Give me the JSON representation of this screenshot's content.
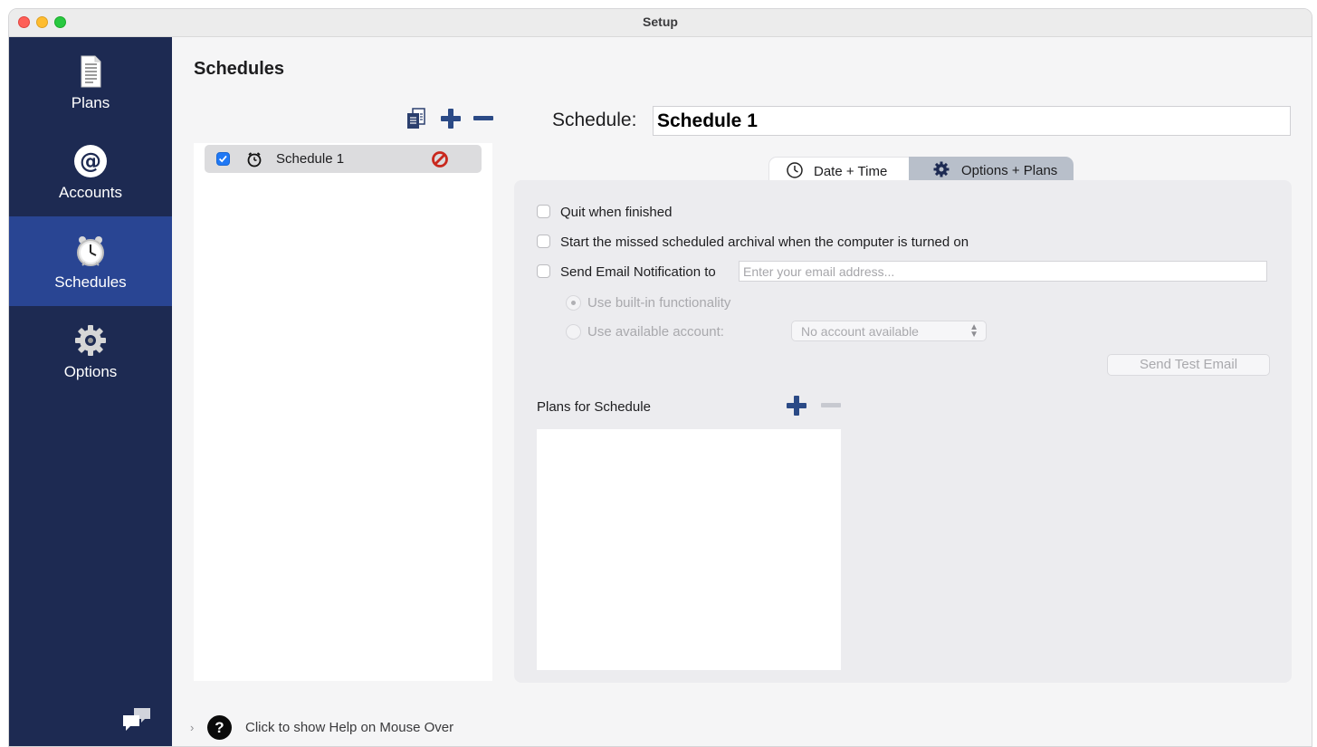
{
  "window": {
    "title": "Setup"
  },
  "sidebar": {
    "items": [
      {
        "label": "Plans",
        "icon": "document-icon",
        "active": false
      },
      {
        "label": "Accounts",
        "icon": "at-sign-icon",
        "active": false
      },
      {
        "label": "Schedules",
        "icon": "alarm-clock-icon",
        "active": true
      },
      {
        "label": "Options",
        "icon": "gear-icon",
        "active": false
      }
    ],
    "footer_icon": "chat-bubbles-icon"
  },
  "main": {
    "title": "Schedules",
    "list_toolbar": {
      "buttons": [
        "duplicate-icon",
        "plus-icon",
        "minus-icon"
      ]
    },
    "schedules": [
      {
        "name": "Schedule 1",
        "enabled": true,
        "icon": "alarm-clock-icon",
        "status_icon": "disabled-icon"
      }
    ]
  },
  "detail": {
    "schedule_label": "Schedule:",
    "schedule_name": "Schedule 1",
    "tabs": [
      {
        "label": "Date + Time",
        "icon": "clock-icon",
        "selected": true
      },
      {
        "label": "Options + Plans",
        "icon": "gear-icon",
        "selected": false
      }
    ],
    "options": {
      "quit_when_finished": {
        "label": "Quit when finished",
        "checked": false
      },
      "start_missed": {
        "label": "Start the missed scheduled archival when the computer is turned on",
        "checked": false
      },
      "send_email": {
        "label": "Send Email Notification to",
        "checked": false,
        "value": "",
        "placeholder": "Enter your email address..."
      },
      "use_builtin": {
        "label": "Use built-in functionality",
        "selected": true
      },
      "use_account": {
        "label": "Use available account:",
        "selected": false
      },
      "account_select": {
        "value": "No account available"
      },
      "send_test_email": "Send Test Email"
    },
    "plans_for_schedule": {
      "label": "Plans for Schedule",
      "items": []
    }
  },
  "help": {
    "text": "Click to show Help on Mouse Over"
  },
  "colors": {
    "sidebar_bg": "#1d2a52",
    "sidebar_active": "#294593",
    "accent_blue": "#2b4a86",
    "checkbox_blue": "#1f78f5",
    "disabled_red": "#c9281d"
  }
}
